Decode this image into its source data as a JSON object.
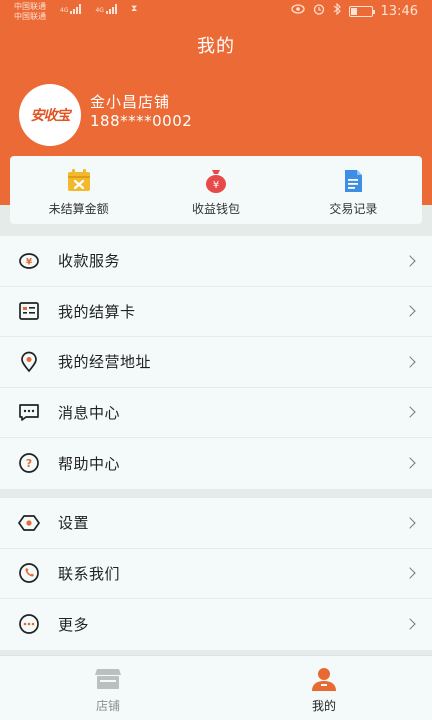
{
  "status_bar": {
    "carrier_1": "中国联通",
    "carrier_2": "中国联通",
    "network_1": "4G",
    "network_2": "4G",
    "time": "13:46"
  },
  "header": {
    "title": "我的",
    "avatar_logo": "安收宝",
    "shop_name": "金小昌店铺",
    "phone": "188****0002"
  },
  "quick_actions": [
    {
      "label": "未结算金额",
      "icon": "unsettled-amount-icon",
      "color": "#f2b82e"
    },
    {
      "label": "收益钱包",
      "icon": "money-bag-icon",
      "color": "#e84a4a"
    },
    {
      "label": "交易记录",
      "icon": "document-icon",
      "color": "#3d8fe6"
    }
  ],
  "menu_group_1": [
    {
      "label": "收款服务",
      "icon": "yuan-circle-icon"
    },
    {
      "label": "我的结算卡",
      "icon": "card-icon"
    },
    {
      "label": "我的经营地址",
      "icon": "location-pin-icon"
    },
    {
      "label": "消息中心",
      "icon": "message-icon"
    },
    {
      "label": "帮助中心",
      "icon": "help-icon"
    }
  ],
  "menu_group_2": [
    {
      "label": "设置",
      "icon": "settings-icon"
    },
    {
      "label": "联系我们",
      "icon": "phone-icon"
    },
    {
      "label": "更多",
      "icon": "more-icon"
    }
  ],
  "tab_bar": {
    "tabs": [
      {
        "label": "店铺",
        "icon": "store-icon",
        "active": false
      },
      {
        "label": "我的",
        "icon": "user-icon",
        "active": true
      }
    ]
  },
  "colors": {
    "brand": "#ec6a35",
    "background": "#e4ecea",
    "card": "#f4faf9",
    "active_tab_icon": "#e86a32",
    "inactive_tab_icon": "#b9c0bf"
  }
}
